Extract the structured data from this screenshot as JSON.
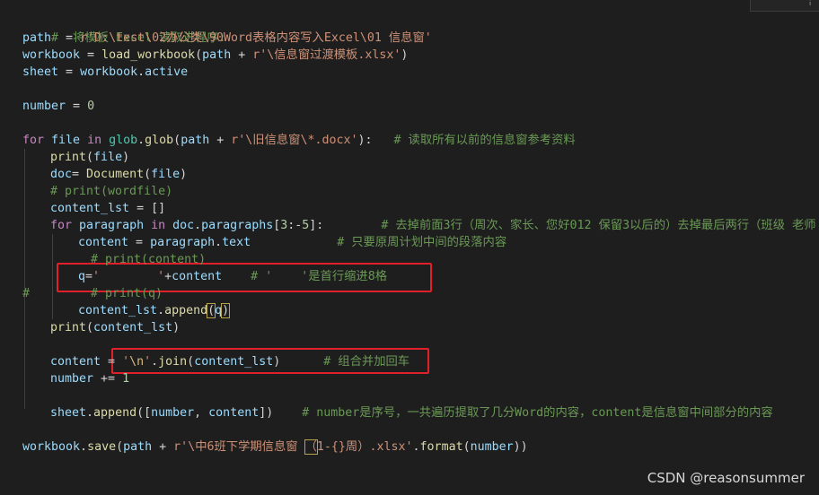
{
  "corner": {
    "label": "¦"
  },
  "code": {
    "line1": {
      "text": "#  将模板 Excel 读取进程序:"
    },
    "line2": {
      "var": "path",
      "eq": "  = ",
      "str": "r'D:\\test\\02办公类\\90Word表格内容写入Excel\\01 信息窗'"
    },
    "line3": {
      "var": "workbook",
      "eq": " = ",
      "fn": "load_workbook",
      "open": "(",
      "arg": "path",
      "plus": " + ",
      "str": "r'\\信息窗过渡模板.xlsx'",
      "close": ")"
    },
    "line4": {
      "var": "sheet",
      "eq": " = ",
      "obj": "workbook",
      "dot": ".",
      "attr": "active"
    },
    "line6": {
      "var": "number",
      "eq": " = ",
      "num": "0"
    },
    "line8": {
      "kw": "for",
      "v1": " file ",
      "kw2": "in",
      "obj": " glob",
      "dot": ".",
      "fn": "glob",
      "open": "(",
      "arg": "path",
      "plus": " + ",
      "str": "r'\\旧信息窗\\*.docx'",
      "close": "):",
      "comment": "   # 读取所有以前的信息窗参考资料"
    },
    "line9": {
      "fn": "print",
      "open": "(",
      "arg": "file",
      "close": ")"
    },
    "line10": {
      "var": "doc",
      "eq": "= ",
      "cls": "Document",
      "open": "(",
      "arg": "file",
      "close": ")"
    },
    "line11": {
      "comment": "# print(wordfile)"
    },
    "line12": {
      "var": "content_lst",
      "eq": " = ",
      "br": "[]"
    },
    "line13": {
      "kw": "for",
      "v1": " paragraph ",
      "kw2": "in",
      "obj": " doc",
      "dot": ".",
      "attr": "paragraphs",
      "open": "[",
      "num1": "3",
      "colon": ":-",
      "num2": "5",
      "close": "]:",
      "comment": "        # 去掉前面3行（周次、家长、您好012 保留3以后的）去掉最后两行（班级 老师"
    },
    "line14": {
      "var": "content",
      "eq": " = ",
      "obj": "paragraph",
      "dot": ".",
      "attr": "text",
      "comment": "            # 只要原周计划中间的段落内容"
    },
    "line15": {
      "comment": "# print(content)"
    },
    "line16": {
      "var": "q",
      "eq": "=",
      "str": "'        '",
      "plus": "+",
      "arg": "content",
      "comment": "    # '    '是首行缩进8格"
    },
    "line17": {
      "hash": "#",
      "comment": "# print(q)"
    },
    "line18": {
      "obj": "content_lst",
      "dot": ".",
      "fn": "append",
      "open": "(",
      "arg": "q",
      "close": ")"
    },
    "line19": {
      "fn": "print",
      "open": "(",
      "arg": "content_lst",
      "close": ")"
    },
    "line21": {
      "var": "content",
      "eq": " = ",
      "str1": "'",
      "esc": "\\n",
      "str2": "'",
      "dot": ".",
      "fn": "join",
      "open": "(",
      "arg": "content_lst",
      "close": ")",
      "comment": "      # 组合并加回车"
    },
    "line22": {
      "var": "number",
      "op": " += ",
      "num": "1"
    },
    "line24": {
      "obj": "sheet",
      "dot": ".",
      "fn": "append",
      "open": "([",
      "a1": "number",
      "sep": ", ",
      "a2": "content",
      "close": "])",
      "comment": "    # number是序号，一共遍历提取了几分Word的内容，content是信息窗中间部分的内容"
    },
    "line26": {
      "obj": "workbook",
      "dot": ".",
      "fn": "save",
      "open": "(",
      "arg": "path",
      "plus": " + ",
      "str1": "r'\\中6班下学期信息窗 ",
      "paren": "（",
      "str2": "1-{}周）.xlsx'",
      "dot2": ".",
      "fn2": "format",
      "open2": "(",
      "arg2": "number",
      "close": "))"
    }
  },
  "watermark": {
    "text": "CSDN @reasonsummer"
  },
  "colors": {
    "background": "#1e1e1e",
    "comment": "#6a9955",
    "variable": "#9cdcfe",
    "function": "#dcdcaa",
    "string": "#ce9178",
    "keyword": "#c586c0",
    "number": "#b5cea8",
    "highlight_box": "#e0202a"
  }
}
